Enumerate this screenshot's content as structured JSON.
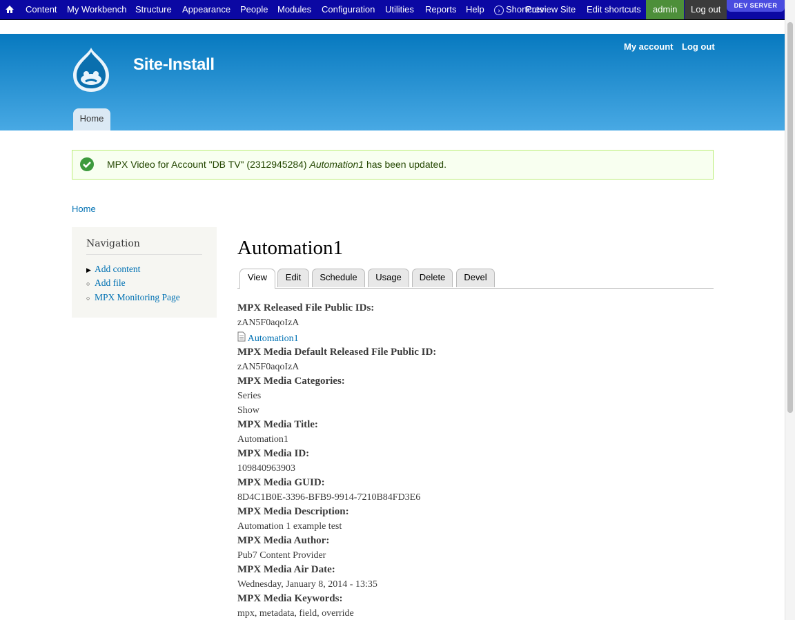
{
  "toolbar": {
    "items": {
      "content": "Content",
      "my_workbench": "My Workbench",
      "structure": "Structure",
      "appearance": "Appearance",
      "people": "People",
      "modules": "Modules",
      "configuration": "Configuration",
      "utilities": "Utilities",
      "reports": "Reports",
      "help": "Help",
      "shortcuts": "Shortcuts",
      "preview_site": "Preview Site",
      "edit_shortcuts": "Edit shortcuts",
      "user": "admin",
      "logout": "Log out"
    },
    "badge": "DEV SERVER",
    "bg_color": "#0b08a3"
  },
  "header": {
    "site_name": "Site-Install",
    "secondary_menu": {
      "my_account": "My account",
      "logout": "Log out"
    },
    "main_tab": "Home"
  },
  "message": {
    "prefix": "MPX Video for Account \"DB TV\" (2312945284) ",
    "title": "Automation1",
    "suffix": " has been updated.",
    "status": "success"
  },
  "breadcrumb": "Home",
  "sidebar": {
    "title": "Navigation",
    "items": [
      "Add content",
      "Add file",
      "MPX Monitoring Page"
    ]
  },
  "page": {
    "title": "Automation1",
    "tabs": [
      "View",
      "Edit",
      "Schedule",
      "Usage",
      "Delete",
      "Devel"
    ],
    "active_tab": "View"
  },
  "fields": {
    "released_file_ids_label": "MPX Released File Public IDs:",
    "released_file_ids_value": "zAN5F0aqoIzA",
    "file_link": "Automation1",
    "default_file_id_label": "MPX Media Default Released File Public ID:",
    "default_file_id_value": "zAN5F0aqoIzA",
    "categories_label": "MPX Media Categories:",
    "categories": [
      "Series",
      "Show"
    ],
    "title_label": "MPX Media Title:",
    "title_value": "Automation1",
    "id_label": "MPX Media ID:",
    "id_value": "109840963903",
    "guid_label": "MPX Media GUID:",
    "guid_value": "8D4C1B0E-3396-BFB9-9914-7210B84FD3E6",
    "description_label": "MPX Media Description:",
    "description_value": "Automation 1 example test",
    "author_label": "MPX Media Author:",
    "author_value": "Pub7 Content Provider",
    "air_date_label": "MPX Media Air Date:",
    "air_date_value": "Wednesday, January 8, 2014 - 13:35",
    "keywords_label": "MPX Media Keywords:",
    "keywords_value": "mpx, metadata, field, override"
  }
}
